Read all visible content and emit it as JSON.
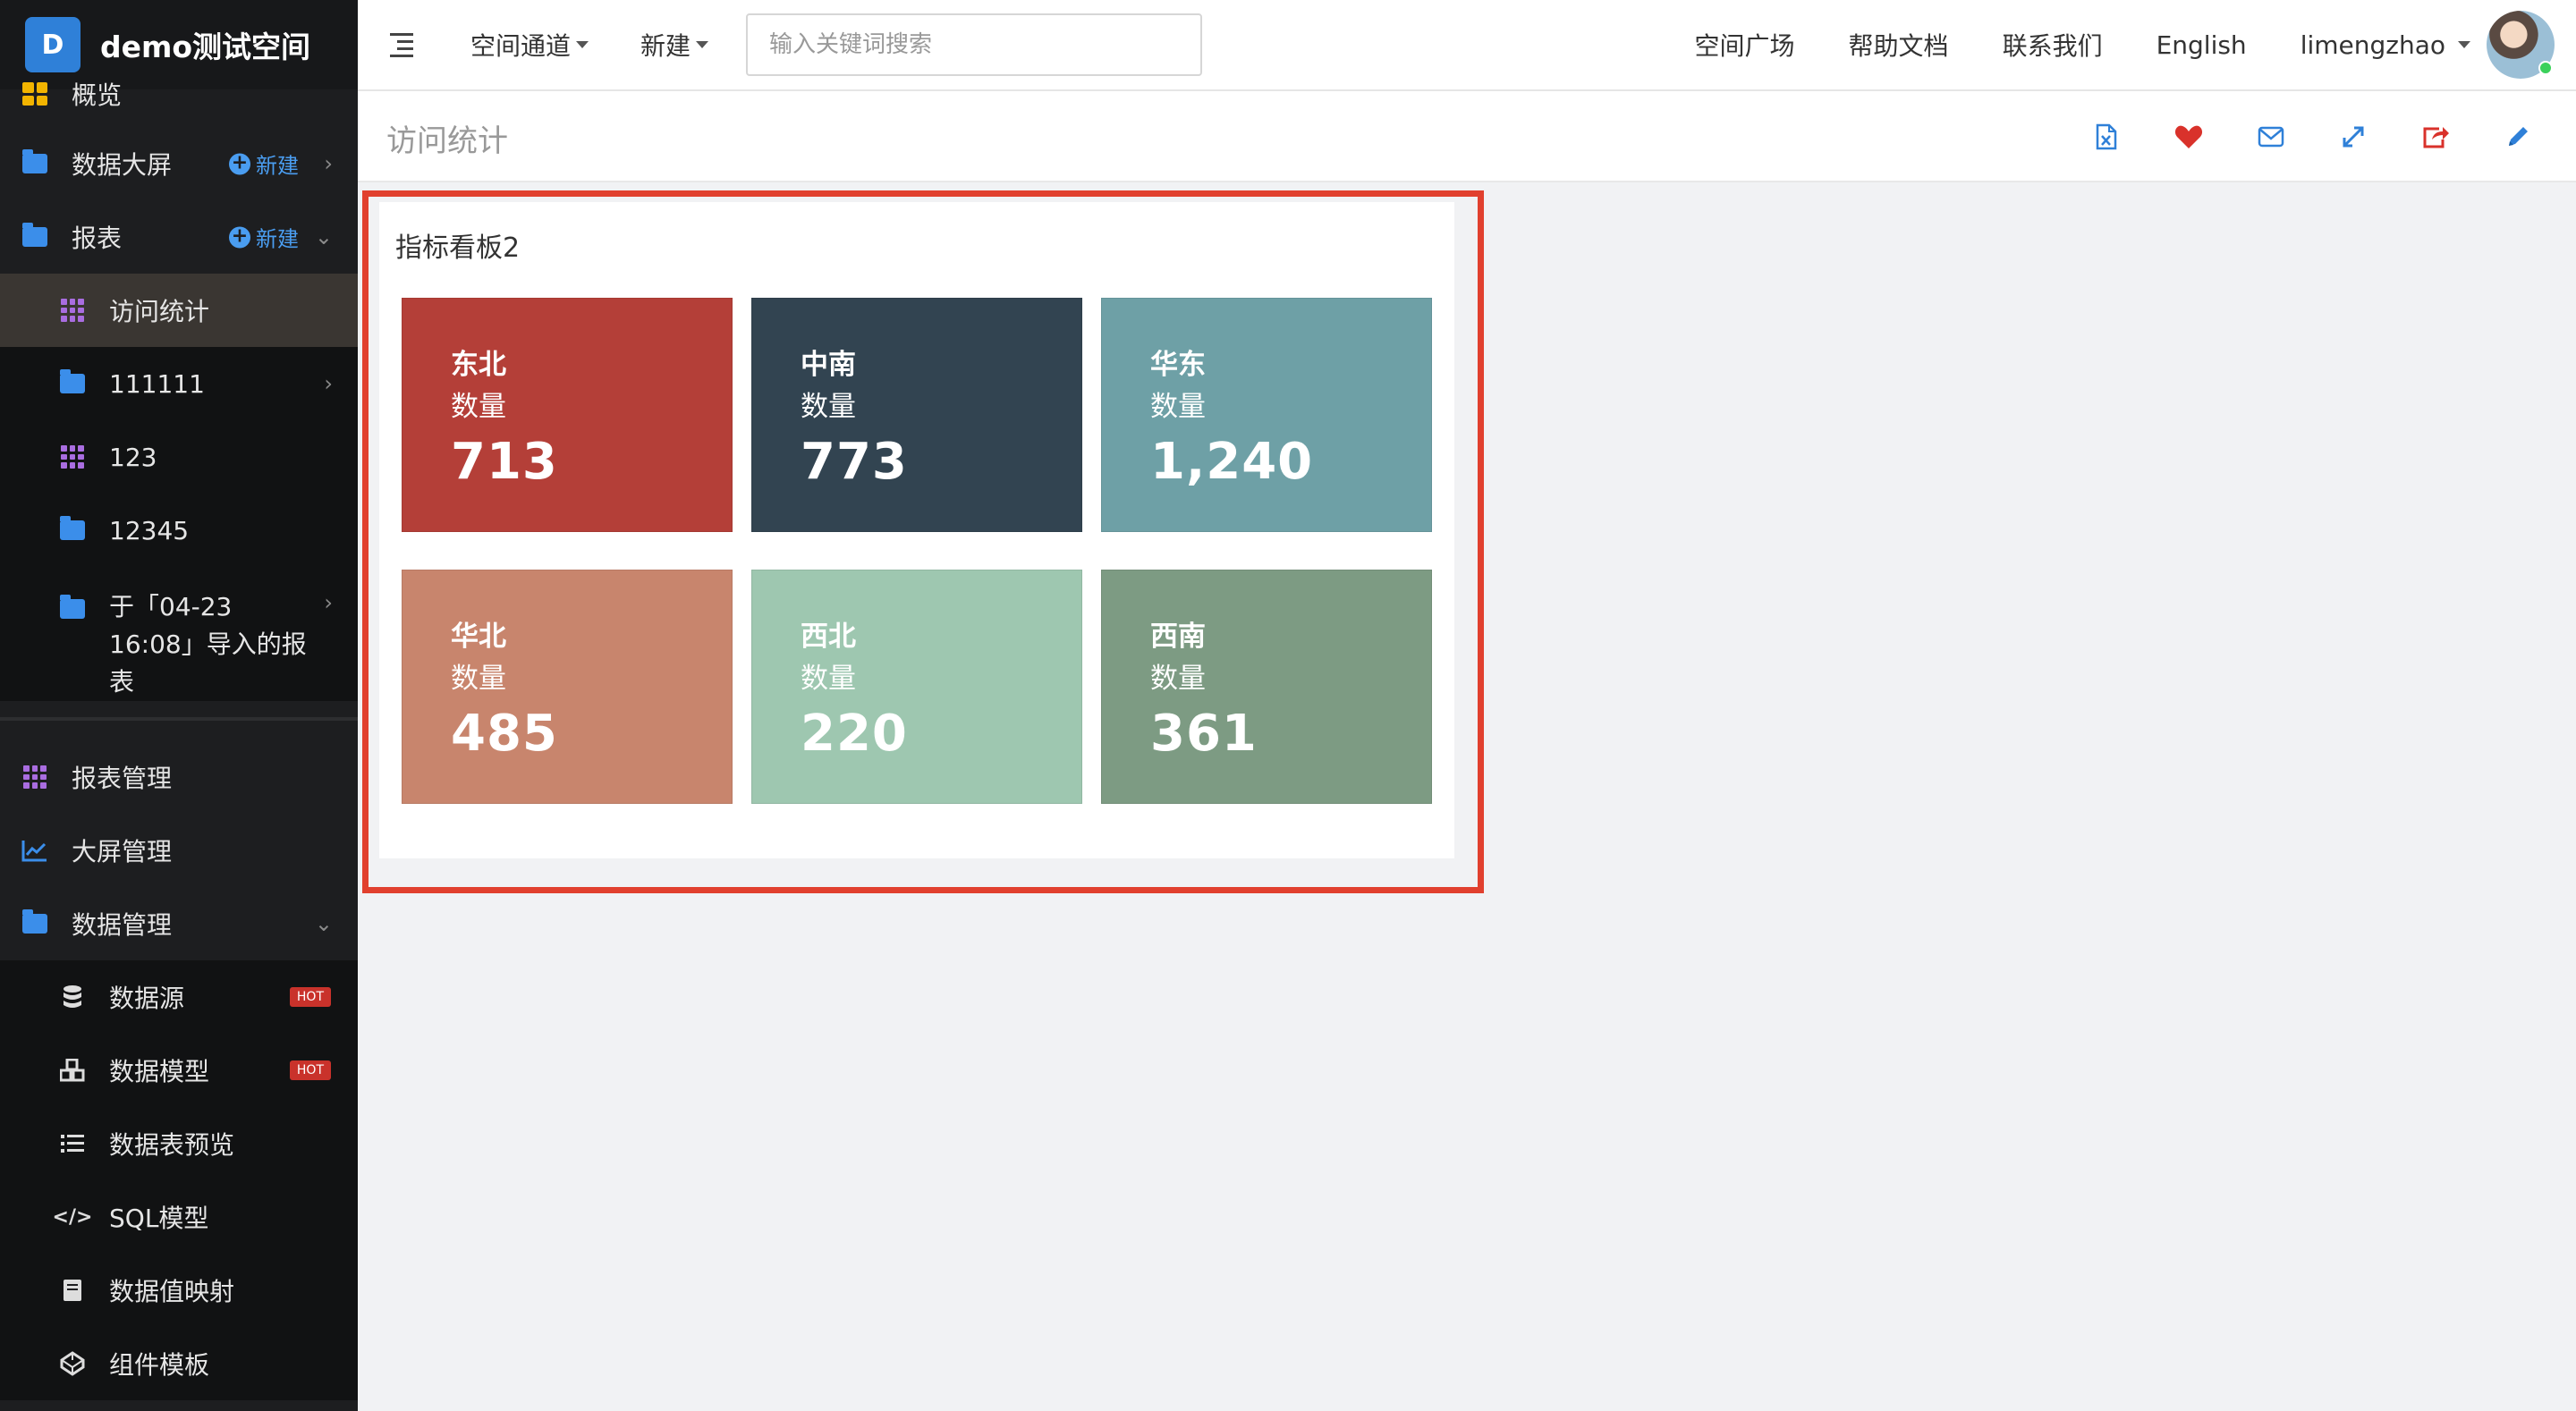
{
  "brand": {
    "logo_letter": "D",
    "name": "demo测试空间"
  },
  "sidebar": {
    "overview": "概览",
    "big_screen": "数据大屏",
    "reports": "报表",
    "new_label": "新建",
    "report_items": [
      "访问统计",
      "111111",
      "123",
      "12345",
      "于「04-23 16:08」导入的报表"
    ],
    "report_mgmt": "报表管理",
    "screen_mgmt": "大屏管理",
    "data_mgmt": "数据管理",
    "data_items": [
      "数据源",
      "数据模型",
      "数据表预览",
      "SQL模型",
      "数据值映射",
      "组件模板"
    ],
    "hot_label": "HOT"
  },
  "topbar": {
    "space_channel": "空间通道",
    "new": "新建",
    "search_placeholder": "输入关键词搜索",
    "plaza": "空间广场",
    "help": "帮助文档",
    "contact": "联系我们",
    "language": "English",
    "username": "limengzhao"
  },
  "page": {
    "title": "访问统计"
  },
  "widget": {
    "title": "指标看板2",
    "tiles": [
      {
        "region": "东北",
        "metric": "数量",
        "value": "713",
        "color": "#b43f38"
      },
      {
        "region": "中南",
        "metric": "数量",
        "value": "773",
        "color": "#324451"
      },
      {
        "region": "华东",
        "metric": "数量",
        "value": "1,240",
        "color": "#6ea0a6"
      },
      {
        "region": "华北",
        "metric": "数量",
        "value": "485",
        "color": "#c8856d"
      },
      {
        "region": "西北",
        "metric": "数量",
        "value": "220",
        "color": "#9ec7b0"
      },
      {
        "region": "西南",
        "metric": "数量",
        "value": "361",
        "color": "#7d9b83"
      }
    ]
  },
  "colors": {
    "accent": "#2f80d8",
    "highlight_border": "#e1402e",
    "action_red": "#d9322b"
  }
}
